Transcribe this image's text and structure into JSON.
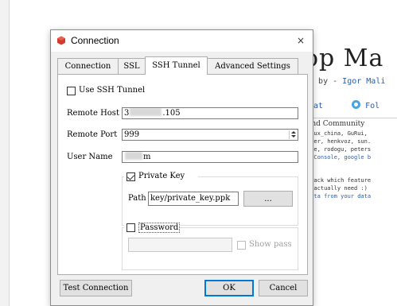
{
  "background": {
    "headline": "op Ma",
    "byline_prefix": "ed by - ",
    "byline_author": "Igor Mali",
    "link_chat": "Chat",
    "link_follow": "Fol",
    "box_heading": "and Community",
    "box_lines": [
      "inux_china, GuRui,",
      "cier, henkvoz, sun.",
      "one, rodogu, peters"
    ],
    "box_link": "QtConsole, google b",
    "box2_lines": [
      "track which feature",
      "u actually need :)"
    ],
    "box2_link": "data from your data"
  },
  "dialog": {
    "title": "Connection",
    "close_label": "×",
    "tabs": [
      {
        "label": "Connection",
        "active": false
      },
      {
        "label": "SSL",
        "active": false
      },
      {
        "label": "SSH Tunnel",
        "active": true
      },
      {
        "label": "Advanced Settings",
        "active": false
      }
    ],
    "use_ssh_tunnel": {
      "label": "Use SSH Tunnel",
      "checked": false
    },
    "remote_host": {
      "label": "Remote Host",
      "value_start": "3",
      "value_end": ".105"
    },
    "remote_port": {
      "label": "Remote Port",
      "value": "999"
    },
    "user_name": {
      "label": "User Name",
      "value_end": "m"
    },
    "private_key": {
      "label": "Private Key",
      "checked": true,
      "path_label": "Path",
      "path_value": "key/private_key.ppk",
      "browse_label": "..."
    },
    "password": {
      "label": "Password",
      "checked": false,
      "value": "",
      "show_pass_label": "Show pass",
      "show_pass_checked": false
    },
    "buttons": {
      "test": "Test Connection",
      "ok": "OK",
      "cancel": "Cancel"
    }
  },
  "colors": {
    "app_icon": "#d23a2b",
    "primary_border": "#0078d7",
    "link": "#2a5db0"
  }
}
